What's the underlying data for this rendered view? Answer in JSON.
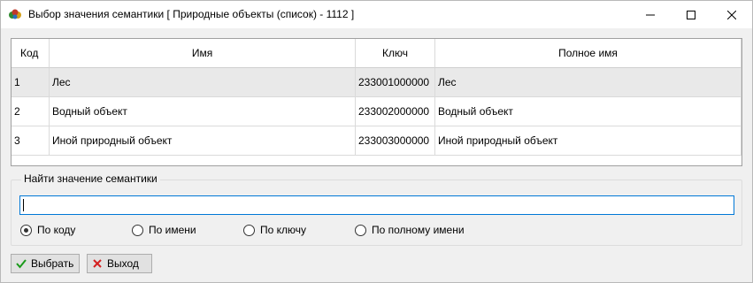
{
  "window": {
    "title": "Выбор значения семантики  [ Природные объекты (список) - 1112 ]",
    "icon": "semantics-app-icon"
  },
  "grid": {
    "columns": [
      "Код",
      "Имя",
      "Ключ",
      "Полное имя"
    ],
    "rows": [
      {
        "code": "1",
        "name": "Лес",
        "key": "233001000000",
        "full_name": "Лес",
        "selected": true
      },
      {
        "code": "2",
        "name": "Водный объект",
        "key": "233002000000",
        "full_name": "Водный объект",
        "selected": false
      },
      {
        "code": "3",
        "name": "Иной природный объект",
        "key": "233003000000",
        "full_name": "Иной природный объект",
        "selected": false
      }
    ]
  },
  "search": {
    "legend": "Найти значение семантики",
    "value": "",
    "options": [
      {
        "label": "По коду",
        "checked": true
      },
      {
        "label": "По имени",
        "checked": false
      },
      {
        "label": "По ключу",
        "checked": false
      },
      {
        "label": "По полному имени",
        "checked": false
      }
    ]
  },
  "buttons": {
    "select_label": "Выбрать",
    "exit_label": "Выход"
  },
  "colors": {
    "accent": "#0078d7",
    "check": "#1a9a1a",
    "cross": "#d42020",
    "selected_row": "#e9e9e9"
  }
}
